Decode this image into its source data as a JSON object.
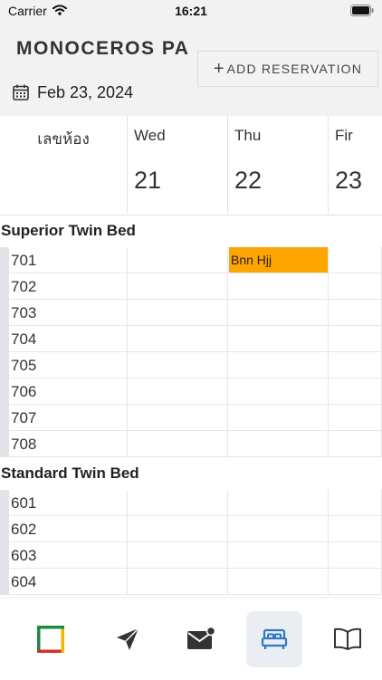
{
  "status_bar": {
    "carrier": "Carrier",
    "time": "16:21"
  },
  "header": {
    "title": "MONOCEROS PARK",
    "add_button": "ADD RESERVATION",
    "date": "Feb 23, 2024"
  },
  "grid": {
    "room_column_label": "เลขห้อง",
    "days": [
      {
        "name": "Wed",
        "number": "21"
      },
      {
        "name": "Thu",
        "number": "22"
      },
      {
        "name": "Fir",
        "number": "23"
      }
    ],
    "sections": [
      {
        "title": "Superior Twin Bed",
        "rooms": [
          "701",
          "702",
          "703",
          "704",
          "705",
          "706",
          "707",
          "708"
        ]
      },
      {
        "title": "Standard Twin Bed",
        "rooms": [
          "601",
          "602",
          "603",
          "604"
        ]
      }
    ],
    "bookings": [
      {
        "guest": "Bnn Hjj",
        "room": "701",
        "day": "Thu",
        "color": "#ffa500"
      }
    ]
  },
  "tabbar": {
    "tabs": [
      {
        "icon": "flag-logo-icon",
        "active": false
      },
      {
        "icon": "send-icon",
        "active": false
      },
      {
        "icon": "mail-icon",
        "active": false
      },
      {
        "icon": "bed-icon",
        "active": true
      },
      {
        "icon": "book-icon",
        "active": false
      }
    ],
    "active_color": "#2f78c4"
  }
}
